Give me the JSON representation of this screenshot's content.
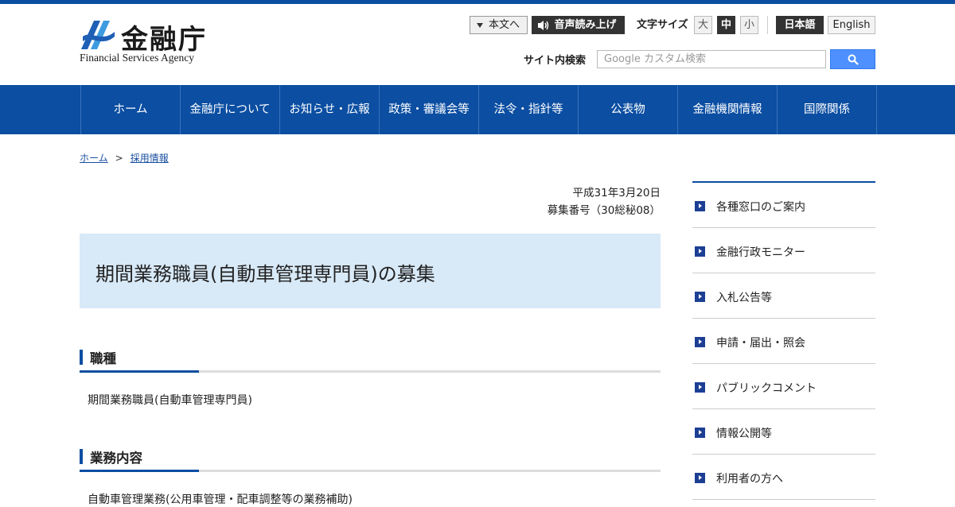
{
  "colors": {
    "brand_blue": "#0b4ea2",
    "title_bg": "#d8e9f7",
    "search_button": "#4d90fe"
  },
  "header": {
    "logo_title": "金融庁",
    "logo_subtitle": "Financial Services Agency",
    "skip_label": "本文へ",
    "voice_label": "音声読み上げ",
    "font_size_label": "文字サイズ",
    "font_sizes": [
      "大",
      "中",
      "小"
    ],
    "lang_ja": "日本語",
    "lang_en": "English",
    "search_label": "サイト内検索",
    "search_placeholder": "Google カスタム検索",
    "search_icon": "search-icon"
  },
  "nav": [
    "ホーム",
    "金融庁について",
    "お知らせ・広報",
    "政策・審議会等",
    "法令・指針等",
    "公表物",
    "金融機関情報",
    "国際関係"
  ],
  "breadcrumb": {
    "home": "ホーム",
    "separator": ">",
    "current": "採用情報"
  },
  "main": {
    "date": "平成31年3月20日",
    "recruit_no": "募集番号（30総秘08）",
    "title": "期間業務職員(自動車管理専門員)の募集",
    "sections": [
      {
        "heading": "職種",
        "body": "期間業務職員(自動車管理専門員)"
      },
      {
        "heading": "業務内容",
        "body": "自動車管理業務(公用車管理・配車調整等の業務補助)"
      }
    ]
  },
  "sidebar": [
    "各種窓口のご案内",
    "金融行政モニター",
    "入札公告等",
    "申請・届出・照会",
    "パブリックコメント",
    "情報公開等",
    "利用者の方へ"
  ]
}
